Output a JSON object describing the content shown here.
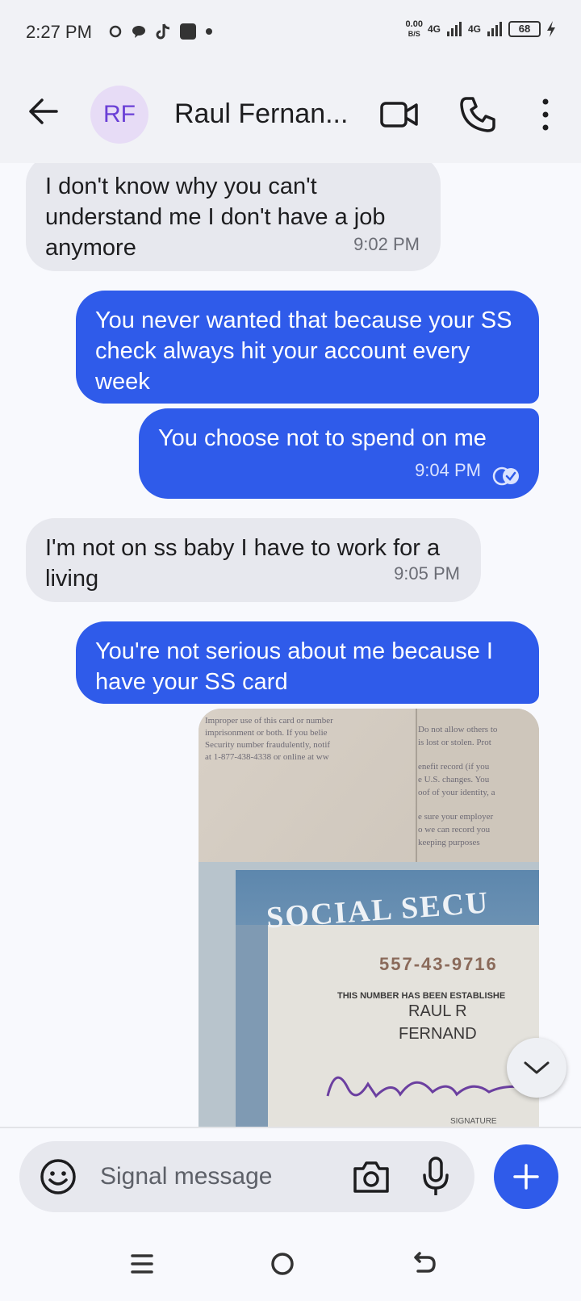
{
  "status_bar": {
    "time": "2:27 PM",
    "speed_value": "0.00",
    "speed_unit": "B/S",
    "network_1": "4G",
    "network_2": "4G",
    "battery": "68"
  },
  "header": {
    "avatar_initials": "RF",
    "contact_name": "Raul Fernan..."
  },
  "messages": [
    {
      "direction": "incoming",
      "text": "I don't know why you can't understand me I don't have a job anymore",
      "time": "9:02 PM"
    },
    {
      "direction": "outgoing",
      "text": "You never wanted that because your SS check always hit your account every week",
      "time": ""
    },
    {
      "direction": "outgoing",
      "text": "You choose not to spend on me",
      "time": "9:04 PM",
      "status": "delivered"
    },
    {
      "direction": "incoming",
      "text": "I'm not on ss baby I have to work for a living",
      "time": "9:05 PM"
    },
    {
      "direction": "outgoing",
      "text": "You're not serious about me because I have your SS card",
      "time": ""
    }
  ],
  "image": {
    "header_text": "SOCIAL SECU",
    "card_number": "557-43-9716",
    "number_caption": "THIS NUMBER HAS BEEN ESTABLISHE",
    "name_line1": "RAUL R",
    "name_line2": "FERNAND",
    "signature_label": "SIGNATURE",
    "back_text_left": [
      "Improper use of this card or number",
      "imprisonment or both. If you belie",
      "Security number fraudulently, notif",
      "at 1-877-438-4338 or online at ww"
    ],
    "back_text_right": [
      "Do not allow others to",
      "is lost or stolen. Prot",
      "enefit record (if you",
      "e U.S. changes. You",
      "oof of your identity, a",
      "e sure your employer",
      "o we can record you",
      "keeping purposes"
    ]
  },
  "composer": {
    "placeholder": "Signal message"
  },
  "colors": {
    "outgoing_bubble": "#2f5bea",
    "incoming_bubble": "#e7e8ee",
    "avatar_bg": "#e7dcf6",
    "avatar_text": "#6a3fd6"
  }
}
